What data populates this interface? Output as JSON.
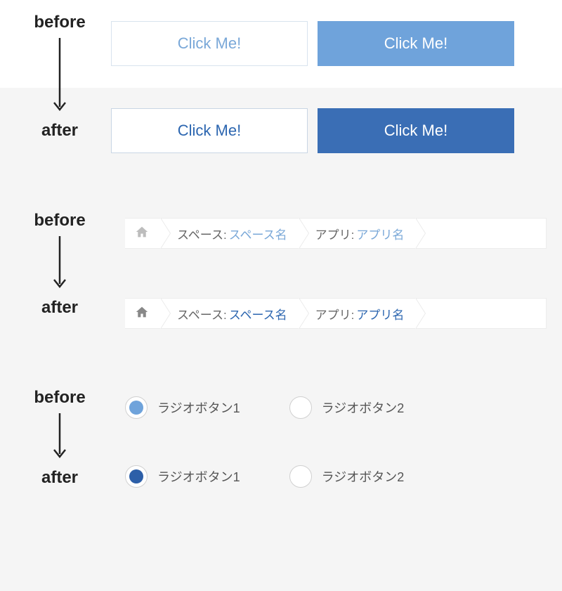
{
  "labels": {
    "before": "before",
    "after": "after"
  },
  "colors": {
    "light_blue": "#6fa3db",
    "dark_blue": "#3a6eb5",
    "link_before": "#7aa8d8",
    "link_after": "#2c66b0"
  },
  "section1": {
    "button_label": "Click Me!"
  },
  "section2": {
    "space_label": "スペース: ",
    "space_link": "スペース名",
    "app_label": "アプリ: ",
    "app_link": "アプリ名"
  },
  "section3": {
    "radio1": "ラジオボタン1",
    "radio2": "ラジオボタン2"
  }
}
